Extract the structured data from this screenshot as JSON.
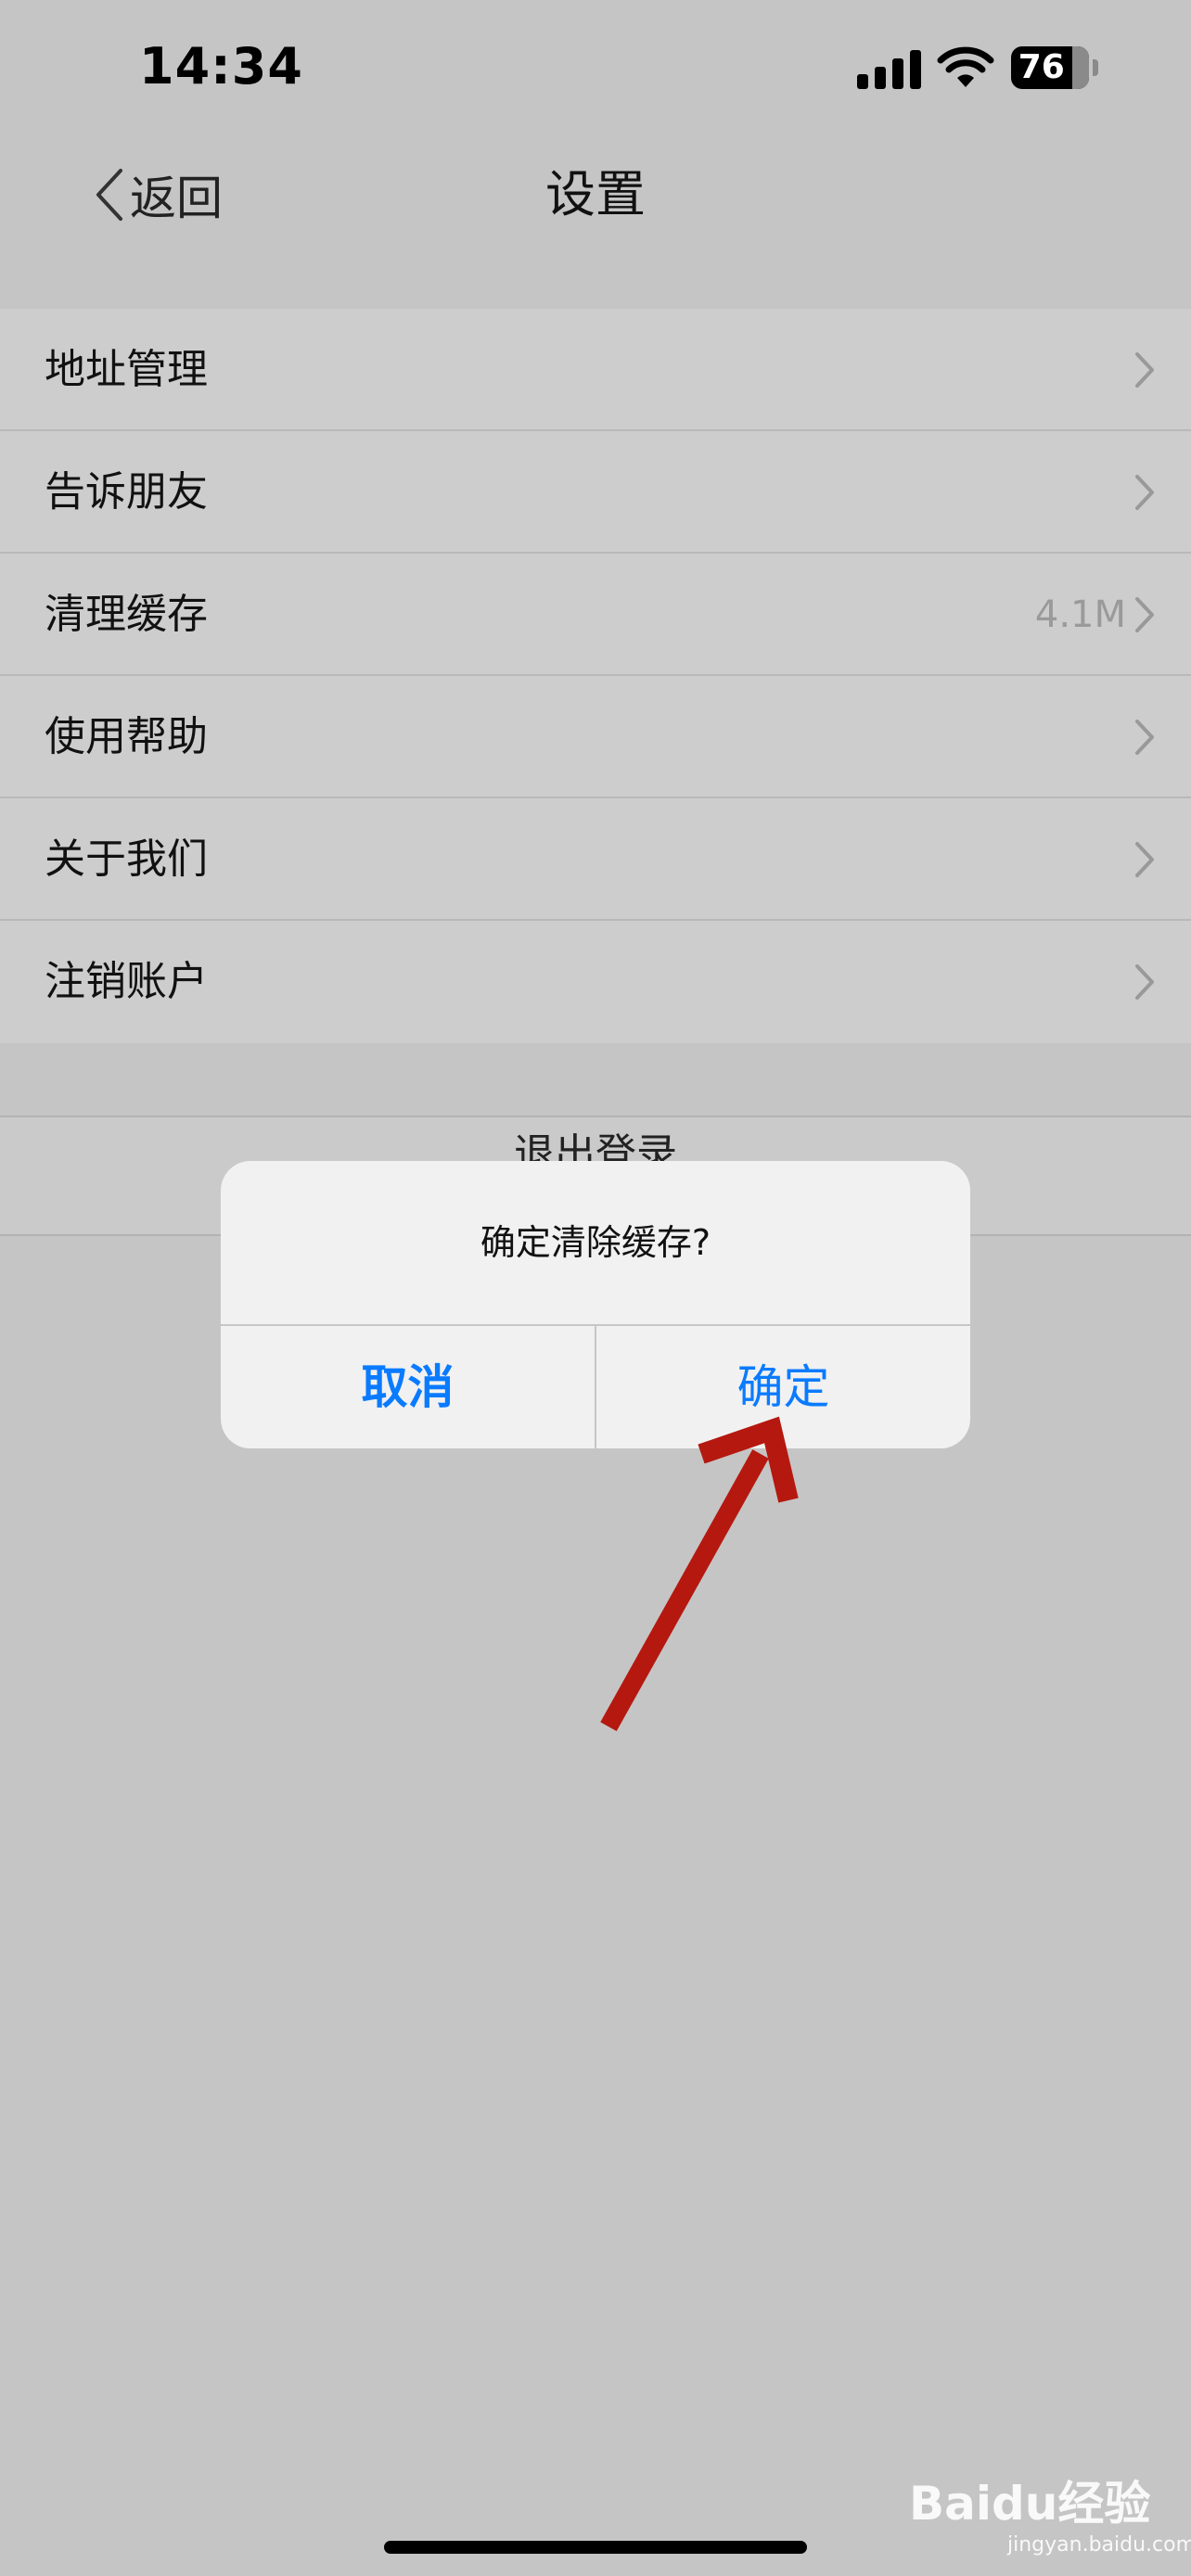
{
  "status_bar": {
    "time": "14:34",
    "battery": "76"
  },
  "nav": {
    "back_label": "返回",
    "title": "设置"
  },
  "settings": {
    "items": [
      {
        "label": "地址管理",
        "value": ""
      },
      {
        "label": "告诉朋友",
        "value": ""
      },
      {
        "label": "清理缓存",
        "value": "4.1M"
      },
      {
        "label": "使用帮助",
        "value": ""
      },
      {
        "label": "关于我们",
        "value": ""
      },
      {
        "label": "注销账户",
        "value": ""
      }
    ]
  },
  "logout": {
    "label": "退出登录"
  },
  "alert": {
    "message": "确定清除缓存?",
    "cancel_label": "取消",
    "confirm_label": "确定"
  },
  "watermark": {
    "text": "Baidu经验",
    "url": "jingyan.baidu.com"
  },
  "colors": {
    "accent": "#0a7bff",
    "arrow": "#b5180f",
    "background": "#c5c5c5"
  }
}
